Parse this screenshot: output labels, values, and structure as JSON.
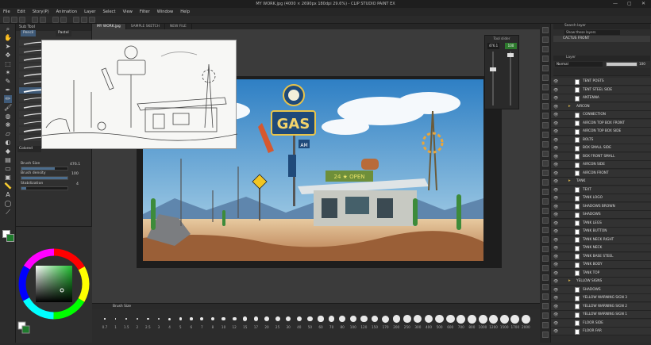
{
  "window": {
    "title": "MY WORK.jpg (4000 × 2690px 180dpi 29.6%) - CLIP STUDIO PAINT EX",
    "controls": [
      "—",
      "▢",
      "✕"
    ]
  },
  "menu": [
    "File",
    "Edit",
    "Story(P)",
    "Animation",
    "Layer",
    "Select",
    "View",
    "Filter",
    "Window",
    "Help"
  ],
  "doc_tabs": [
    "MY WORK.jpg",
    "SAMPLE SKETCH",
    "NEW FILE"
  ],
  "subtool": {
    "panel_title": "Sub Tool",
    "tabs": [
      "Pencil",
      "Pastel"
    ],
    "current_brush": "Colored pencil"
  },
  "tool_property": {
    "brush_size": {
      "label": "Brush Size",
      "value": "476.1",
      "fraction": 0.72
    },
    "brush_density": {
      "label": "Brush density",
      "value": "100",
      "fraction": 1.0
    },
    "stabilization": {
      "label": "Stabilization",
      "value": "4",
      "fraction": 0.1
    }
  },
  "color": {
    "main": "#ffffff",
    "sub": "#1e7b2c",
    "wheel_sv": "#3fbe48"
  },
  "float_panel": {
    "title": "Tool slider",
    "left_value": "476.1",
    "right_value": "100"
  },
  "brush_size_palette": {
    "title": "Brush Size",
    "sizes": [
      "0.7",
      "1",
      "1.5",
      "2",
      "2.5",
      "3",
      "4",
      "5",
      "6",
      "7",
      "8",
      "10",
      "12",
      "15",
      "17",
      "20",
      "25",
      "30",
      "40",
      "50",
      "60",
      "70",
      "80",
      "100",
      "120",
      "150",
      "170",
      "200",
      "250",
      "300",
      "400",
      "500",
      "600",
      "700",
      "800",
      "1000",
      "1200",
      "1500",
      "1700",
      "2000"
    ]
  },
  "layer_panel": {
    "search_label": "Search layer",
    "filter_label": "Show these layers",
    "folder": "CACTUS FRONT",
    "tab": "Layer",
    "blend_mode": "Normal",
    "opacity": "100",
    "layers": [
      {
        "name": "TENT POSTS",
        "type": "layer"
      },
      {
        "name": "TENT STEEL SIDE",
        "type": "layer"
      },
      {
        "name": "ANTENNA",
        "type": "layer"
      },
      {
        "name": "AIRCON",
        "type": "folder"
      },
      {
        "name": "CONNECTION",
        "type": "layer"
      },
      {
        "name": "AIRCON TOP BOX FRONT",
        "type": "layer"
      },
      {
        "name": "AIRCON TOP BOX SIDE",
        "type": "layer"
      },
      {
        "name": "BOLTS",
        "type": "layer"
      },
      {
        "name": "BOX SMALL SIDE",
        "type": "layer"
      },
      {
        "name": "BOX FRONT SMALL",
        "type": "layer"
      },
      {
        "name": "AIRCON SIDE",
        "type": "layer"
      },
      {
        "name": "AIRCON FRONT",
        "type": "layer"
      },
      {
        "name": "TANK",
        "type": "folder"
      },
      {
        "name": "TEXT",
        "type": "layer"
      },
      {
        "name": "TANK LOGO",
        "type": "layer"
      },
      {
        "name": "SHADOWS BROWN",
        "type": "layer"
      },
      {
        "name": "SHADOWS",
        "type": "layer"
      },
      {
        "name": "TANK LEGS",
        "type": "layer"
      },
      {
        "name": "TANK BUTTON",
        "type": "layer"
      },
      {
        "name": "TANK NECK RIGHT",
        "type": "layer"
      },
      {
        "name": "TANK NECK",
        "type": "layer"
      },
      {
        "name": "TANK BASE STEEL",
        "type": "layer"
      },
      {
        "name": "TANK BODY",
        "type": "layer"
      },
      {
        "name": "TANK TOP",
        "type": "layer"
      },
      {
        "name": "YELLOW SIGNS",
        "type": "folder"
      },
      {
        "name": "SHADOWS",
        "type": "layer"
      },
      {
        "name": "YELLOW WARNING SIGN 3",
        "type": "layer"
      },
      {
        "name": "YELLOW WARNING SIGN 2",
        "type": "layer"
      },
      {
        "name": "YELLOW WARNING SIGN 1",
        "type": "layer"
      },
      {
        "name": "FLOOR SIDE",
        "type": "layer"
      },
      {
        "name": "FLOOR FAR",
        "type": "layer"
      }
    ]
  },
  "artwork": {
    "sign_text": "GAS",
    "sign_sub": "AM",
    "banner_text": "24 ★ OPEN"
  }
}
